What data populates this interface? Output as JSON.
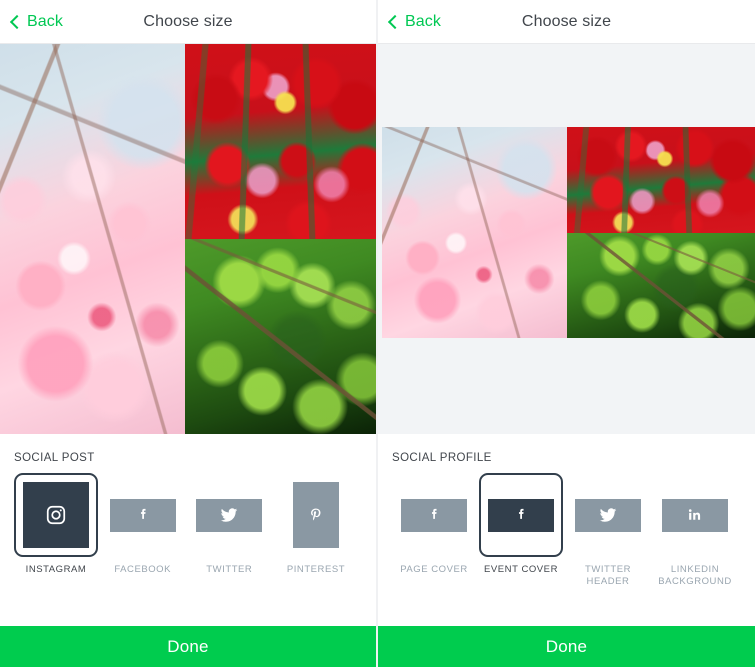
{
  "panels": [
    {
      "nav": {
        "back_label": "Back",
        "title": "Choose size",
        "back_icon": "chevron-left-icon"
      },
      "canvas": {
        "background": "#ffffff",
        "aspect": "square",
        "photos": [
          {
            "name": "cherry-blossom-photo",
            "alt": "Pink cherry blossoms against blue sky"
          },
          {
            "name": "red-tulips-photo",
            "alt": "Field of red and pink tulips"
          },
          {
            "name": "green-leaves-photo",
            "alt": "Bright green maidenhair fern leaves"
          }
        ]
      },
      "group_title": "SOCIAL POST",
      "tiles": [
        {
          "label": "INSTAGRAM",
          "icon": "instagram-icon",
          "shape": "square",
          "selected": true
        },
        {
          "label": "FACEBOOK",
          "icon": "facebook-icon",
          "shape": "wide",
          "selected": false
        },
        {
          "label": "TWITTER",
          "icon": "twitter-icon",
          "shape": "wide",
          "selected": false
        },
        {
          "label": "PINTEREST",
          "icon": "pinterest-icon",
          "shape": "tall",
          "selected": false
        }
      ],
      "footer": {
        "label": "Done"
      }
    },
    {
      "nav": {
        "back_label": "Back",
        "title": "Choose size",
        "back_icon": "chevron-left-icon"
      },
      "canvas": {
        "background": "#f2f4f6",
        "aspect": "event-cover",
        "photos": [
          {
            "name": "cherry-blossom-photo",
            "alt": "Pink cherry blossoms against blue sky"
          },
          {
            "name": "red-tulips-photo",
            "alt": "Field of red and pink tulips"
          },
          {
            "name": "green-leaves-photo",
            "alt": "Bright green maidenhair fern leaves"
          }
        ]
      },
      "group_title": "SOCIAL PROFILE",
      "tiles": [
        {
          "label": "PAGE COVER",
          "icon": "facebook-icon",
          "shape": "wide",
          "selected": false
        },
        {
          "label": "EVENT COVER",
          "icon": "facebook-icon",
          "shape": "wide",
          "selected": true
        },
        {
          "label": "TWITTER HEADER",
          "icon": "twitter-icon",
          "shape": "wide",
          "selected": false
        },
        {
          "label": "LINKEDIN\nBACKGROUND",
          "icon": "linkedin-icon",
          "shape": "wide",
          "selected": false
        }
      ],
      "footer": {
        "label": "Done"
      }
    }
  ],
  "colors": {
    "accent_green": "#00cc4e",
    "tile_selected": "#323f4c",
    "tile_default": "#8a98a3",
    "label_muted": "#9aa6b0",
    "text_dark": "#41464c",
    "canvas_gray": "#f2f4f6"
  }
}
